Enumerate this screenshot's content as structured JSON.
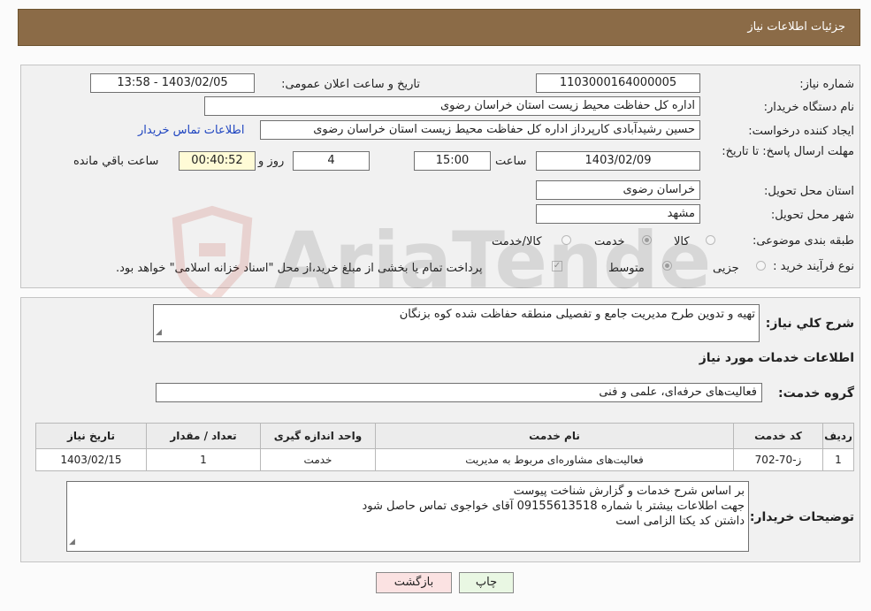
{
  "header": {
    "title": "جزئیات اطلاعات نیاز"
  },
  "form": {
    "need_number_label": "شماره نیاز:",
    "need_number": "1103000164000005",
    "announce_label": "تاریخ و ساعت اعلان عمومی:",
    "announce_value": "1403/02/05 - 13:58",
    "buyer_org_label": "نام دستگاه خريدار:",
    "buyer_org": "اداره کل حفاظت محیط زیست استان خراسان رضوی",
    "creator_label": "ایجاد کننده درخواست:",
    "creator": "حسین رشیدآبادی کارپرداز اداره کل حفاظت محیط زیست استان خراسان رضوی",
    "contact_link": "اطلاعات تماس خريدار",
    "deadline_label": "مهلت ارسال پاسخ: تا تاریخ:",
    "deadline_date": "1403/02/09",
    "hour_label": "ساعت",
    "deadline_time": "15:00",
    "days": "4",
    "days_label": "روز و",
    "remaining": "00:40:52",
    "remaining_label": "ساعت باقي مانده",
    "province_label": "استان محل تحویل:",
    "province": "خراسان رضوی",
    "city_label": "شهر محل تحویل:",
    "city": "مشهد",
    "category_label": "طبقه بندی موضوعی:",
    "category_options": [
      "کالا",
      "خدمت",
      "کالا/خدمت"
    ],
    "category_selected": "خدمت",
    "process_label": "نوع فرآیند خرید :",
    "process_options": [
      "جزیی",
      "متوسط"
    ],
    "process_selected": "متوسط",
    "payment_note": "پرداخت تمام یا بخشی از مبلغ خرید،از محل \"اسناد خزانه اسلامی\" خواهد بود."
  },
  "details": {
    "general_desc_label": "شرح کلي نياز:",
    "general_desc": "تهیه و تدوین طرح مدیریت جامع و تفصیلی منطقه حفاظت شده کوه بزنگان",
    "services_heading": "اطلاعات خدمات مورد نياز",
    "service_group_label": "گروه خدمت:",
    "service_group": "فعالیت‌های حرفه‌ای، علمی و فنی",
    "table": {
      "headers": [
        "ردیف",
        "کد خدمت",
        "نام خدمت",
        "واحد اندازه گیری",
        "تعداد / مقدار",
        "تاریخ نیاز"
      ],
      "rows": [
        [
          "1",
          "ز-70-702",
          "فعالیت‌های مشاوره‌ای مربوط به مدیریت",
          "خدمت",
          "1",
          "1403/02/15"
        ]
      ]
    },
    "buyer_notes_label": "توضيحات خريدار:",
    "buyer_notes": [
      "بر اساس شرح خدمات و گزارش شناخت پیوست",
      "جهت اطلاعات بیشتر با شماره 09155613518 آقای خواجوی تماس حاصل شود",
      "داشتن کد یکتا الزامی است"
    ]
  },
  "buttons": {
    "print": "چاپ",
    "back": "بازگشت"
  },
  "watermark": {
    "text": "AriaTender.net"
  }
}
